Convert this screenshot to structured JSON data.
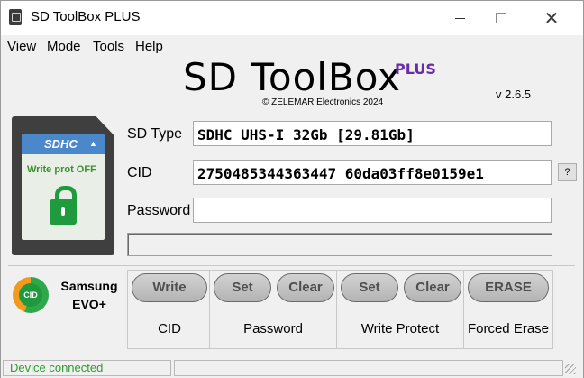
{
  "window": {
    "title": "SD ToolBox PLUS",
    "close_glyph": "✕"
  },
  "menu": {
    "items": [
      "View",
      "Mode",
      "Tools",
      "Help"
    ]
  },
  "header": {
    "logo": "SD ToolBox",
    "logo_suffix": "PLUS",
    "copyright": "© ZELEMAR Electronics 2024",
    "version": "v 2.6.5"
  },
  "card": {
    "type": "SDHC",
    "arrow": "▲",
    "write_protect": "Write prot OFF",
    "lock_state": "unlocked"
  },
  "fields": {
    "sd_type": {
      "label": "SD Type",
      "value": "SDHC UHS-I 32Gb [29.81Gb]"
    },
    "cid": {
      "label": "CID",
      "value": "2750485344363447 60da03ff8e0159e1"
    },
    "password": {
      "label": "Password",
      "value": ""
    },
    "cid_help": "?"
  },
  "progress": {
    "value": 0
  },
  "vendor": {
    "badge": "CID",
    "name_line1": "Samsung",
    "name_line2": "EVO+"
  },
  "actions": {
    "cid": {
      "write": "Write",
      "label": "CID"
    },
    "password": {
      "set": "Set",
      "clear": "Clear",
      "label": "Password"
    },
    "write_protect": {
      "set": "Set",
      "clear": "Clear",
      "label": "Write Protect"
    },
    "forced_erase": {
      "erase": "ERASE",
      "label": "Forced Erase"
    }
  },
  "status": {
    "text": "Device connected",
    "color": "#2e9a2e"
  },
  "colors": {
    "accent": "#6a2ca8",
    "card_blue": "#4b87cb",
    "lock_green": "#1f9a3d"
  }
}
